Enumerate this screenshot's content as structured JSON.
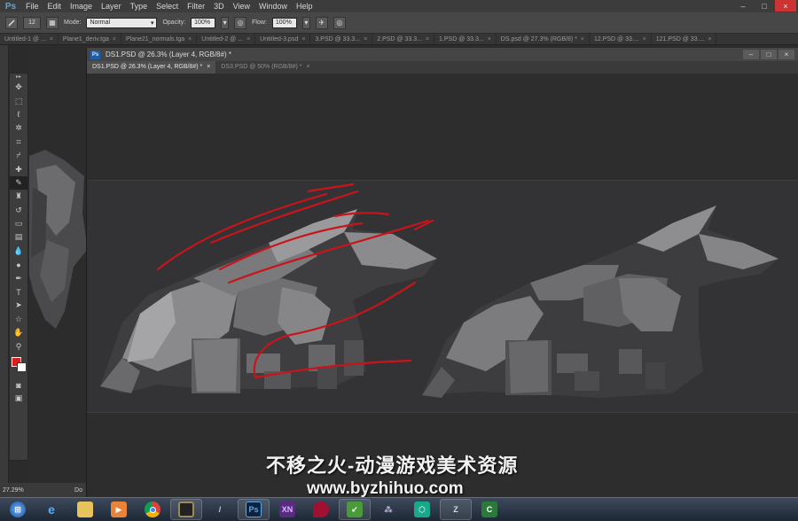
{
  "app": {
    "logo": "Ps"
  },
  "menu": [
    "File",
    "Edit",
    "Image",
    "Layer",
    "Type",
    "Select",
    "Filter",
    "3D",
    "View",
    "Window",
    "Help"
  ],
  "window_controls": [
    "–",
    "□",
    "×"
  ],
  "options_bar": {
    "brush_size": "12",
    "mode_label": "Mode:",
    "mode_value": "Normal",
    "opacity_label": "Opacity:",
    "opacity_value": "100%",
    "flow_label": "Flow:",
    "flow_value": "100%"
  },
  "doc_tabs": [
    "Untitled-1 @ ...",
    "Plane1_deriv.tga",
    "Plane21_normals.tga",
    "Untitled-2 @ ...",
    "Untitled-3.psd",
    "3.PSD @ 33.3...",
    "2.PSD @ 33.3...",
    "1.PSD @ 33.3...",
    "DS.psd @ 27.3% (RGB/8) *",
    "12.PSD @ 33....",
    "121.PSD @ 33...."
  ],
  "doc_window": {
    "title": "DS1.PSD @ 26.3% (Layer 4, RGB/8#) *",
    "tabs": [
      "DS1.PSD @ 26.3% (Layer 4, RGB/8#) *",
      "DS3.PSD @ 50% (RGB/8#) *"
    ]
  },
  "status": {
    "zoom": "27.29%",
    "doc": "Do"
  },
  "watermark": {
    "line1": "不移之火-动漫游戏美术资源",
    "line2": "www.byzhihuo.com"
  },
  "colors": {
    "foreground": "#d32020",
    "background": "#ffffff",
    "sketch_stroke": "#c8141a"
  },
  "tools": [
    "move-icon",
    "marquee-icon",
    "lasso-icon",
    "magic-wand-icon",
    "crop-icon",
    "eyedropper-icon",
    "healing-icon",
    "brush-icon",
    "stamp-icon",
    "history-brush-icon",
    "eraser-icon",
    "gradient-icon",
    "blur-icon",
    "dodge-icon",
    "pen-icon",
    "type-icon",
    "path-select-icon",
    "shape-icon",
    "hand-icon",
    "zoom-icon"
  ],
  "taskbar": [
    "start-orb-icon",
    "internet-explorer-icon",
    "file-explorer-icon",
    "media-player-icon",
    "chrome-icon",
    "camera-app-icon",
    "brush-app-icon",
    "photoshop-icon",
    "xnview-icon",
    "red-app-icon",
    "green-app-icon",
    "network-app-icon",
    "3d-app-icon",
    "zbrush-icon",
    "camtasia-icon"
  ]
}
